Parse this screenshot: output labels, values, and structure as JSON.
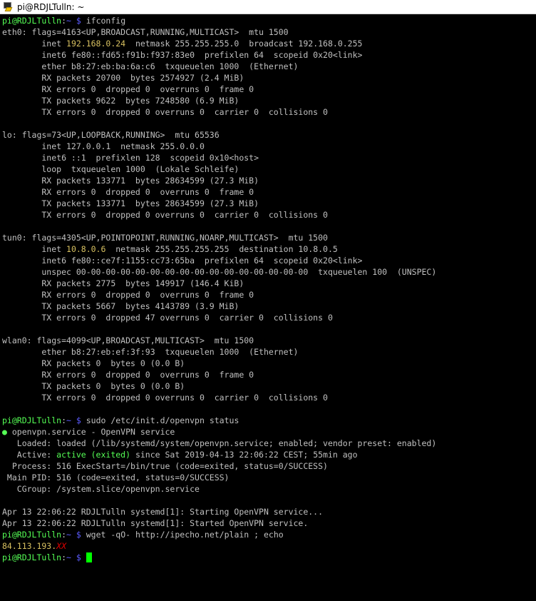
{
  "window": {
    "title": "pi@RDJLTulln: ~"
  },
  "prompt": {
    "user_host": "pi@RDJLTulln",
    "path": "~",
    "symbol": "$"
  },
  "lines": [
    {
      "type": "prompt",
      "cmd": "ifconfig"
    },
    {
      "text": "eth0: flags=4163<UP,BROADCAST,RUNNING,MULTICAST>  mtu 1500"
    },
    {
      "parts": [
        "        inet ",
        "192.168.0.24",
        "  netmask 255.255.255.0  broadcast 192.168.0.255"
      ]
    },
    {
      "text": "        inet6 fe80::fd65:f91b:f937:83e0  prefixlen 64  scopeid 0x20<link>"
    },
    {
      "text": "        ether b8:27:eb:ba:6a:c6  txqueuelen 1000  (Ethernet)"
    },
    {
      "text": "        RX packets 20700  bytes 2574927 (2.4 MiB)"
    },
    {
      "text": "        RX errors 0  dropped 0  overruns 0  frame 0"
    },
    {
      "text": "        TX packets 9622  bytes 7248580 (6.9 MiB)"
    },
    {
      "text": "        TX errors 0  dropped 0 overruns 0  carrier 0  collisions 0"
    },
    {
      "text": ""
    },
    {
      "text": "lo: flags=73<UP,LOOPBACK,RUNNING>  mtu 65536"
    },
    {
      "text": "        inet 127.0.0.1  netmask 255.0.0.0"
    },
    {
      "text": "        inet6 ::1  prefixlen 128  scopeid 0x10<host>"
    },
    {
      "text": "        loop  txqueuelen 1000  (Lokale Schleife)"
    },
    {
      "text": "        RX packets 133771  bytes 28634599 (27.3 MiB)"
    },
    {
      "text": "        RX errors 0  dropped 0  overruns 0  frame 0"
    },
    {
      "text": "        TX packets 133771  bytes 28634599 (27.3 MiB)"
    },
    {
      "text": "        TX errors 0  dropped 0 overruns 0  carrier 0  collisions 0"
    },
    {
      "text": ""
    },
    {
      "text": "tun0: flags=4305<UP,POINTOPOINT,RUNNING,NOARP,MULTICAST>  mtu 1500"
    },
    {
      "parts": [
        "        inet ",
        "10.8.0.6",
        "  netmask 255.255.255.255  destination 10.8.0.5"
      ]
    },
    {
      "text": "        inet6 fe80::ce7f:1155:cc73:65ba  prefixlen 64  scopeid 0x20<link>"
    },
    {
      "text": "        unspec 00-00-00-00-00-00-00-00-00-00-00-00-00-00-00-00  txqueuelen 100  (UNSPEC)"
    },
    {
      "text": "        RX packets 2775  bytes 149917 (146.4 KiB)"
    },
    {
      "text": "        RX errors 0  dropped 0  overruns 0  frame 0"
    },
    {
      "text": "        TX packets 5667  bytes 4143789 (3.9 MiB)"
    },
    {
      "text": "        TX errors 0  dropped 47 overruns 0  carrier 0  collisions 0"
    },
    {
      "text": ""
    },
    {
      "text": "wlan0: flags=4099<UP,BROADCAST,MULTICAST>  mtu 1500"
    },
    {
      "text": "        ether b8:27:eb:ef:3f:93  txqueuelen 1000  (Ethernet)"
    },
    {
      "text": "        RX packets 0  bytes 0 (0.0 B)"
    },
    {
      "text": "        RX errors 0  dropped 0  overruns 0  frame 0"
    },
    {
      "text": "        TX packets 0  bytes 0 (0.0 B)"
    },
    {
      "text": "        TX errors 0  dropped 0 overruns 0  carrier 0  collisions 0"
    },
    {
      "text": ""
    },
    {
      "type": "prompt",
      "cmd": "sudo /etc/init.d/openvpn status"
    },
    {
      "type": "svc",
      "bullet": "●",
      "text": " openvpn.service - OpenVPN service"
    },
    {
      "text": "   Loaded: loaded (/lib/systemd/system/openvpn.service; enabled; vendor preset: enabled)"
    },
    {
      "type": "active",
      "pre": "   Active: ",
      "state": "active (exited)",
      "post": " since Sat 2019-04-13 22:06:22 CEST; 55min ago"
    },
    {
      "text": "  Process: 516 ExecStart=/bin/true (code=exited, status=0/SUCCESS)"
    },
    {
      "text": " Main PID: 516 (code=exited, status=0/SUCCESS)"
    },
    {
      "text": "   CGroup: /system.slice/openvpn.service"
    },
    {
      "text": ""
    },
    {
      "text": "Apr 13 22:06:22 RDJLTulln systemd[1]: Starting OpenVPN service..."
    },
    {
      "text": "Apr 13 22:06:22 RDJLTulln systemd[1]: Started OpenVPN service."
    },
    {
      "type": "prompt",
      "cmd": "wget -qO- http://ipecho.net/plain ; echo"
    },
    {
      "type": "ip",
      "text": "84.113.193.",
      "redacted": "XX"
    },
    {
      "type": "prompt_cursor",
      "cmd": ""
    }
  ],
  "colors": {
    "prompt": "#55ff55",
    "path": "#5c5cff",
    "ip": "#d7c060",
    "cursor": "#00ff00"
  }
}
